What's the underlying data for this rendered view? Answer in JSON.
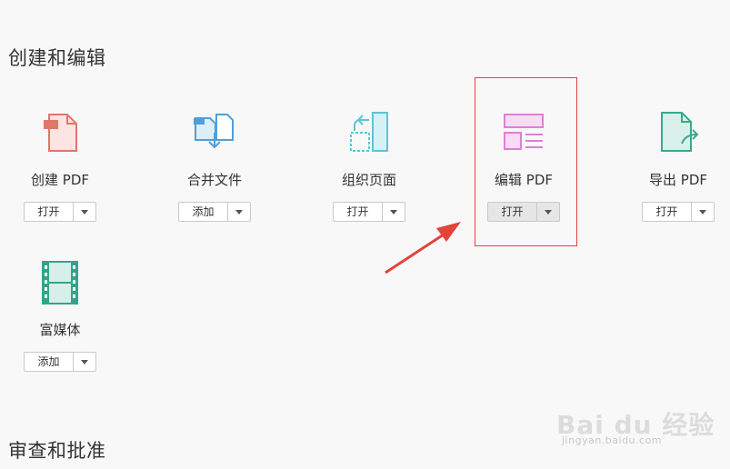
{
  "sections": {
    "create_edit_title": "创建和编辑",
    "review_title": "审查和批准"
  },
  "tools": [
    {
      "label": "创建 PDF",
      "button": "打开",
      "icon": "create-pdf-icon",
      "color": "#e0776b"
    },
    {
      "label": "合并文件",
      "button": "添加",
      "icon": "combine-files-icon",
      "color": "#4f9fd7"
    },
    {
      "label": "组织页面",
      "button": "打开",
      "icon": "organize-pages-icon",
      "color": "#5ec4d6"
    },
    {
      "label": "编辑 PDF",
      "button": "打开",
      "icon": "edit-pdf-icon",
      "color": "#e07ed6"
    },
    {
      "label": "导出 PDF",
      "button": "打开",
      "icon": "export-pdf-icon",
      "color": "#3aa88f"
    },
    {
      "label": "富媒体",
      "button": "添加",
      "icon": "rich-media-icon",
      "color": "#31a58c"
    }
  ],
  "annotation": {
    "color": "#e1443b"
  },
  "watermark": {
    "brand": "Bai du 经验",
    "url": "jingyan.baidu.com"
  }
}
